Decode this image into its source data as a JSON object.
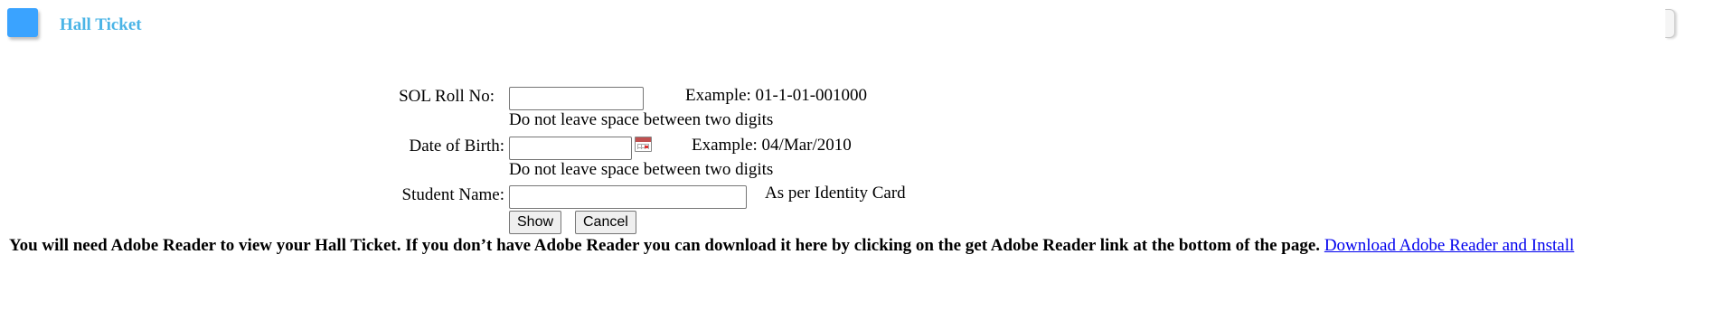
{
  "header": {
    "title": "Hall Ticket",
    "icon_color": "#3aa3ff",
    "title_color": "#4ab4e6"
  },
  "form": {
    "roll_no": {
      "label": "SOL Roll No:",
      "value": "",
      "example": "Example: 01-1-01-001000",
      "hint": "Do not leave space between two digits"
    },
    "dob": {
      "label": "Date of Birth:",
      "value": "",
      "example": "Example: 04/Mar/2010",
      "hint": "Do not leave space between two digits",
      "calendar_icon": "calendar-icon"
    },
    "student_name": {
      "label": "Student Name:",
      "value": "",
      "note": "As per Identity Card"
    },
    "buttons": {
      "show": "Show",
      "cancel": "Cancel"
    }
  },
  "notice": {
    "text": "You will need Adobe Reader to view your Hall Ticket. If you don’t have Adobe Reader you can download it here by clicking on the get Adobe Reader link at the bottom of the page.",
    "link": "Download Adobe Reader and Install",
    "link_color": "#0000ee"
  }
}
